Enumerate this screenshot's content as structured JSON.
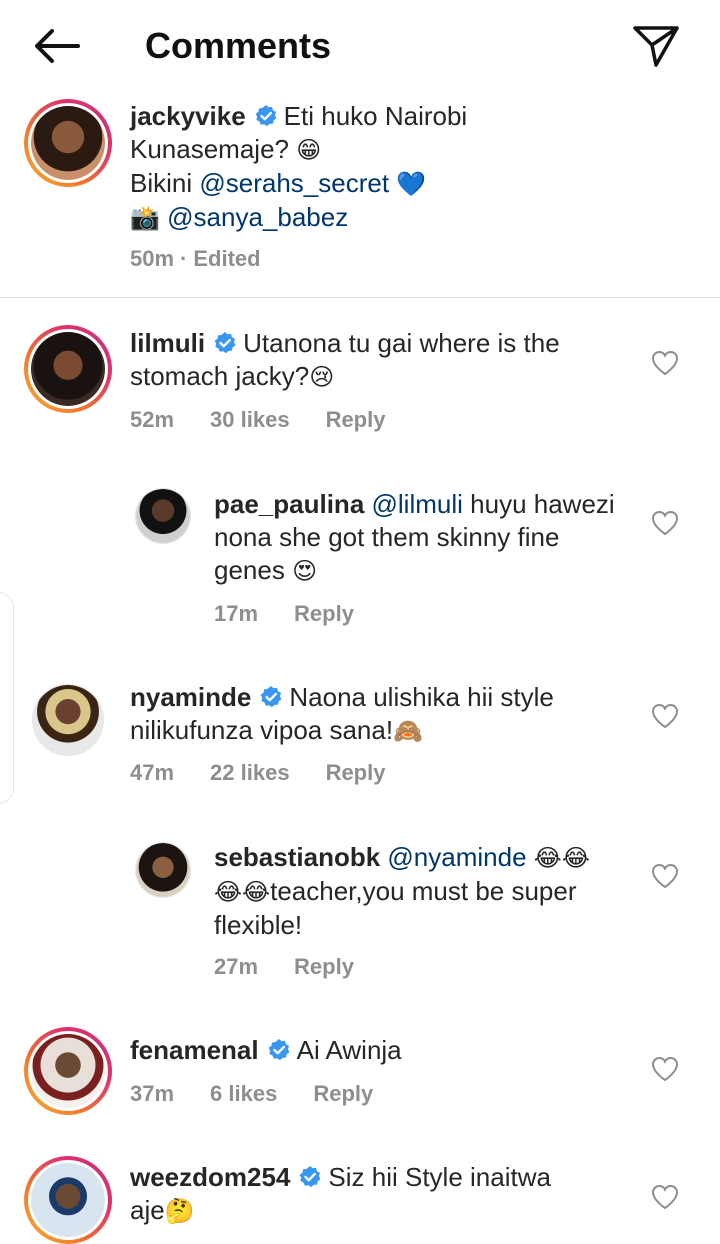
{
  "header": {
    "title": "Comments",
    "back_icon": "arrow-left-icon",
    "send_icon": "paper-plane-icon"
  },
  "caption": {
    "username": "jackyvike",
    "text_line1": "Eti huko Nairobi",
    "text_line2": "Kunasemaje?",
    "emoji1": "😁",
    "bikini_label": "Bikini",
    "mention1": "@serahs_secret",
    "emoji2": "💙",
    "camera_emoji": "📸",
    "mention2": "@sanya_babez",
    "meta_time": "50m",
    "meta_sep": "·",
    "meta_edited": "Edited"
  },
  "comments": [
    {
      "username": "lilmuli",
      "verified": true,
      "text": "Utanona tu gai where is the stomach jacky?",
      "emoji": "😢",
      "time": "52m",
      "likes": "30 likes",
      "reply": "Reply"
    },
    {
      "username": "pae_paulina",
      "verified": false,
      "mention": "@lilmuli",
      "text": "huyu hawezi nona she got them skinny fine genes",
      "emoji": "😍",
      "time": "17m",
      "reply": "Reply"
    },
    {
      "username": "nyaminde",
      "verified": true,
      "text": "Naona ulishika hii style nilikufunza vipoa sana!",
      "emoji": "🙈",
      "time": "47m",
      "likes": "22 likes",
      "reply": "Reply"
    },
    {
      "username": "sebastianobk",
      "verified": false,
      "mention": "@nyaminde",
      "emoji_a": "😂😂",
      "emoji_b": "😂😂",
      "text": "teacher,you must be super flexible!",
      "time": "27m",
      "reply": "Reply"
    },
    {
      "username": "fenamenal",
      "verified": true,
      "text": "Ai Awinja",
      "time": "37m",
      "likes": "6 likes",
      "reply": "Reply"
    },
    {
      "username": "weezdom254",
      "verified": true,
      "text_line1": "Siz hii Style inaitwa",
      "text_line2": "aje",
      "emoji": "🤔"
    }
  ],
  "colors": {
    "verified_blue": "#3897f0",
    "mention_blue": "#00376b",
    "meta_gray": "#8e8e8e"
  }
}
